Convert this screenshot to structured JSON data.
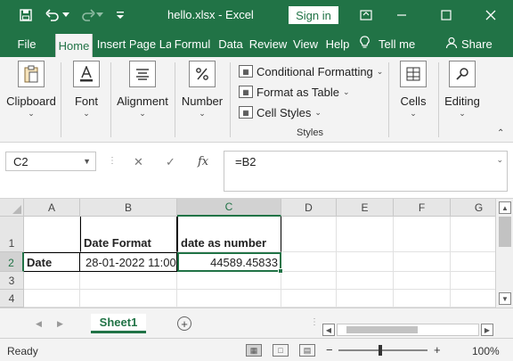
{
  "window": {
    "title": "hello.xlsx  -  Excel",
    "sign_in_label": "Sign in",
    "accent_color": "#217346"
  },
  "quick_access": {
    "icons": [
      "save-icon",
      "undo-icon",
      "undo-dropdown-icon",
      "redo-icon",
      "redo-dropdown-icon",
      "customize-qat-icon"
    ]
  },
  "tabs": [
    {
      "label": "File",
      "active": false
    },
    {
      "label": "Home",
      "active": true
    },
    {
      "label": "Insert",
      "active": false
    },
    {
      "label": "Page La",
      "active": false
    },
    {
      "label": "Formul",
      "active": false
    },
    {
      "label": "Data",
      "active": false
    },
    {
      "label": "Review",
      "active": false
    },
    {
      "label": "View",
      "active": false
    },
    {
      "label": "Help",
      "active": false
    }
  ],
  "tell_me": {
    "label": "Tell me",
    "icon": "lightbulb-icon"
  },
  "share": {
    "label": "Share",
    "icon": "person-icon"
  },
  "ribbon": {
    "groups": {
      "clipboard": "Clipboard",
      "font": "Font",
      "alignment": "Alignment",
      "number": "Number",
      "cells": "Cells",
      "editing": "Editing",
      "styles": "Styles"
    },
    "styles_items": [
      "Conditional Formatting",
      "Format as Table",
      "Cell Styles"
    ]
  },
  "formula_bar": {
    "name_box": "C2",
    "formula": "=B2",
    "fx_label": "fx"
  },
  "sheet": {
    "columns": [
      "A",
      "B",
      "C",
      "D",
      "E",
      "F",
      "G"
    ],
    "rows": [
      "1",
      "2",
      "3",
      "4"
    ],
    "selected_cell": "C2",
    "cells": {
      "B1": "Date Format",
      "C1": "date as number",
      "A2": "Date",
      "B2": "28-01-2022 11:00",
      "C2": "44589.45833"
    }
  },
  "sheet_tabs": [
    {
      "label": "Sheet1",
      "active": true
    }
  ],
  "status_bar": {
    "status": "Ready",
    "zoom": "100%"
  }
}
